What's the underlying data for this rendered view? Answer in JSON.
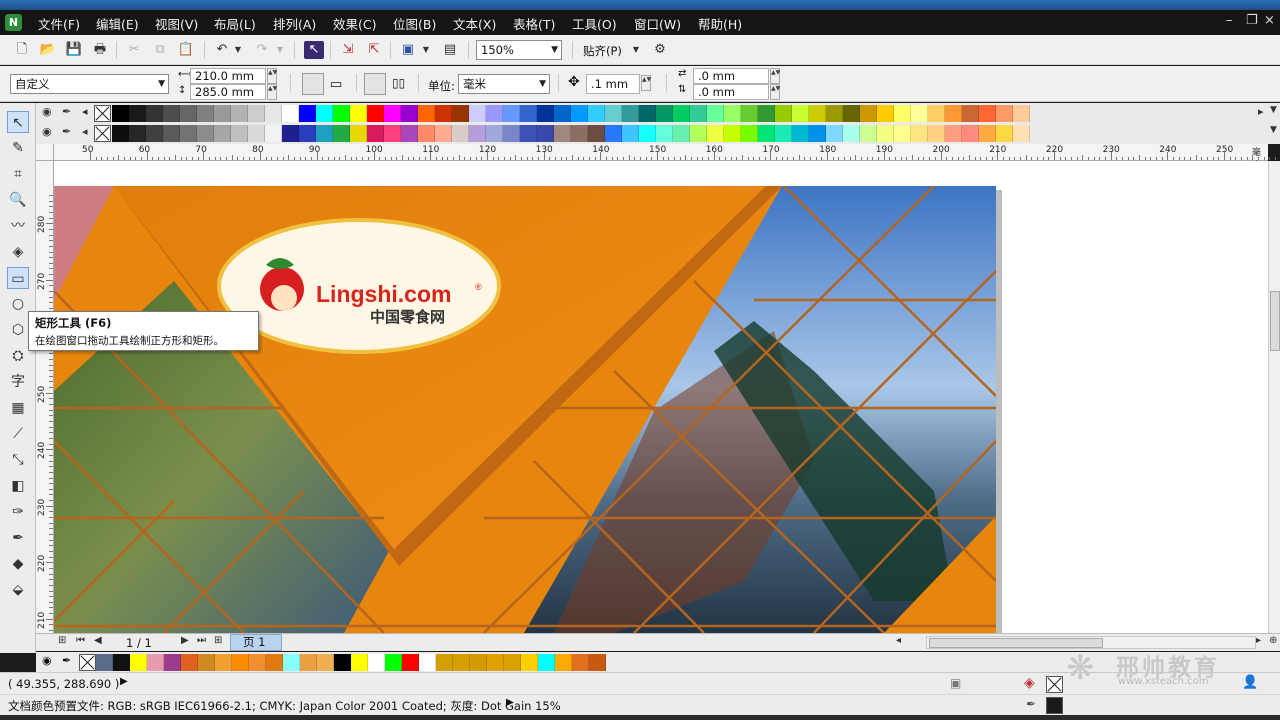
{
  "app": {
    "logo_glyph": "N"
  },
  "menu": [
    "文件(F)",
    "编辑(E)",
    "视图(V)",
    "布局(L)",
    "排列(A)",
    "效果(C)",
    "位图(B)",
    "文本(X)",
    "表格(T)",
    "工具(O)",
    "窗口(W)",
    "帮助(H)"
  ],
  "window_controls": [
    "minimize-icon",
    "restore-icon",
    "close-icon"
  ],
  "toolbar": {
    "zoom_value": "150%",
    "snap_label": "贴齐(P)"
  },
  "property_bar": {
    "page_preset": "自定义",
    "width": "210.0 mm",
    "height": "285.0 mm",
    "unit_label": "单位:",
    "unit_value": "毫米",
    "nudge": ".1 mm",
    "dup_x": ".0 mm",
    "dup_y": ".0 mm"
  },
  "palette": {
    "row1": [
      "#000000",
      "#1a1a1a",
      "#333333",
      "#4d4d4d",
      "#666666",
      "#808080",
      "#999999",
      "#b3b3b3",
      "#cccccc",
      "#e6e6e6",
      "#ffffff",
      "#0000ff",
      "#00ffff",
      "#00ff00",
      "#ffff00",
      "#ff0000",
      "#ff00ff",
      "#9900cc",
      "#ff6600",
      "#cc3300",
      "#993300",
      "#ccccff",
      "#9999ff",
      "#6699ff",
      "#3366cc",
      "#003399",
      "#0066cc",
      "#0099ff",
      "#33ccff",
      "#66cccc",
      "#339999",
      "#006666",
      "#009966",
      "#00cc66",
      "#33cc99",
      "#66ff99",
      "#99ff66",
      "#66cc33",
      "#339933",
      "#99cc00",
      "#ccff33",
      "#cccc00",
      "#999900",
      "#666600",
      "#cc9900",
      "#ffcc00",
      "#ffff66",
      "#ffff99",
      "#ffcc66",
      "#ff9933",
      "#cc6633",
      "#ff6633",
      "#ff9966",
      "#ffcc99"
    ],
    "row2": [
      "#0d0d0d",
      "#262626",
      "#404040",
      "#595959",
      "#737373",
      "#8c8c8c",
      "#a6a6a6",
      "#bfbfbf",
      "#d9d9d9",
      "#f2f2f2",
      "#1f1f8f",
      "#2a3fbf",
      "#20a0c0",
      "#22aa44",
      "#e6d800",
      "#d81b60",
      "#ff4081",
      "#ab47bc",
      "#ff8a65",
      "#ffab91",
      "#d7ccc8",
      "#b39ddb",
      "#9fa8da",
      "#7986cb",
      "#3f51b5",
      "#3949ab",
      "#a1887f",
      "#8d6e63",
      "#6d4c41",
      "#2979ff",
      "#40c4ff",
      "#18ffff",
      "#64ffda",
      "#69f0ae",
      "#b2ff59",
      "#eeff41",
      "#c6ff00",
      "#76ff03",
      "#00e676",
      "#1de9b6",
      "#00b8d4",
      "#0091ea",
      "#80d8ff",
      "#a7ffeb",
      "#ccff90",
      "#f4ff81",
      "#ffff8d",
      "#ffe57f",
      "#ffd180",
      "#ff9e80",
      "#ff8a80",
      "#ffab40",
      "#ffd740",
      "#ffe0b2"
    ],
    "doc": [
      "#5a6b8c",
      "#111111",
      "#ffff00",
      "#e89ab0",
      "#9b3d8c",
      "#e06020",
      "#d08a20",
      "#f0a030",
      "#ff8a00",
      "#f09030",
      "#e07a10",
      "#88ffff",
      "#e8a040",
      "#f0b050",
      "#000000",
      "#ffff00",
      "#ffffff",
      "#00ff00",
      "#ff0000",
      "#ffffff",
      "#d4a000",
      "#d69e00",
      "#d39b00",
      "#e0a000",
      "#d8a000",
      "#ffd000",
      "#00ffff",
      "#ffaa00",
      "#e07020",
      "#c85a10"
    ]
  },
  "ruler": {
    "h_labels": [
      "50",
      "60",
      "70",
      "80",
      "90",
      "100",
      "110",
      "120",
      "130",
      "140",
      "150",
      "160",
      "170",
      "180",
      "190",
      "200",
      "210",
      "220",
      "230",
      "240",
      "250"
    ],
    "unit_marker": "毫米",
    "v_labels": [
      "280",
      "270",
      "260",
      "250",
      "240",
      "230",
      "220",
      "210"
    ]
  },
  "tooltip": {
    "title": "矩形工具 (F6)",
    "description": "在绘图窗口拖动工具绘制正方形和矩形。"
  },
  "artwork": {
    "logo_text": "Lingshi.com",
    "logo_sub": "中国零食网",
    "registered": "®",
    "orange": "#e8850c",
    "line_color": "#b5651d"
  },
  "page_nav": {
    "page_info": "1 / 1",
    "page_tab": "页 1"
  },
  "status": {
    "coords": "( 49.355, 288.690 )",
    "color_profile": "文档颜色预置文件: RGB: sRGB IEC61966-2.1; CMYK: Japan Color 2001 Coated; 灰度: Dot Gain 15%"
  },
  "watermark": {
    "brand": "邢帅教育",
    "url": "www.xsteach.com"
  }
}
